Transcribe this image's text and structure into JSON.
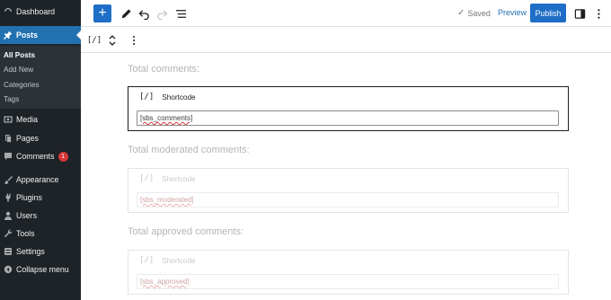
{
  "sidebar": {
    "dashboard": "Dashboard",
    "posts": "Posts",
    "submenu": [
      "All Posts",
      "Add New",
      "Categories",
      "Tags"
    ],
    "media": "Media",
    "pages": "Pages",
    "comments": "Comments",
    "comments_count": "1",
    "appearance": "Appearance",
    "plugins": "Plugins",
    "users": "Users",
    "tools": "Tools",
    "settings": "Settings",
    "collapse": "Collapse menu"
  },
  "toolbar": {
    "add_label": "+",
    "status": "Saved",
    "preview": "Preview",
    "publish": "Publish"
  },
  "block_toolbar": {
    "block_icon": "[/]"
  },
  "content": {
    "blocks": [
      {
        "heading": "Total comments:",
        "block_name": "Shortcode",
        "shortcode": "[sbs_comments]",
        "selected": true
      },
      {
        "heading": "Total moderated comments:",
        "block_name": "Shortcode",
        "shortcode": "[sbs_moderated]",
        "selected": false
      },
      {
        "heading": "Total approved comments:",
        "block_name": "Shortcode",
        "shortcode": "[sbs_approved]",
        "selected": false
      }
    ]
  },
  "colors": {
    "sidebar_bg": "#1d2327",
    "accent": "#2271b1",
    "publish_bg": "#1e6ec8",
    "badge": "#d63638"
  }
}
